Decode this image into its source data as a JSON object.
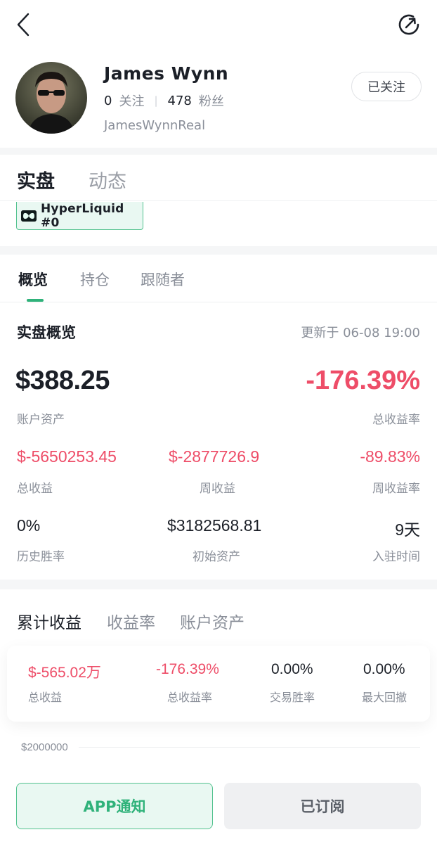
{
  "profile": {
    "name": "James Wynn",
    "following_count": "0",
    "following_label": "关注",
    "followers_count": "478",
    "followers_label": "粉丝",
    "handle": "JamesWynnReal",
    "follow_button": "已关注"
  },
  "main_tabs": [
    {
      "label": "实盘",
      "active": true
    },
    {
      "label": "动态",
      "active": false
    }
  ],
  "exchange": {
    "label": "HyperLiquid #0",
    "icon": "hyperliquid-logo"
  },
  "sub_tabs": [
    {
      "label": "概览",
      "active": true
    },
    {
      "label": "持仓",
      "active": false
    },
    {
      "label": "跟随者",
      "active": false
    }
  ],
  "overview": {
    "title": "实盘概览",
    "updated": "更新于 06-08 19:00",
    "account_asset": {
      "value": "$388.25",
      "label": "账户资产"
    },
    "total_return_rate": {
      "value": "-176.39%",
      "label": "总收益率"
    },
    "stats": [
      {
        "value": "$-5650253.45",
        "label": "总收益",
        "color": "#ee4d68"
      },
      {
        "value": "$-2877726.9",
        "label": "周收益",
        "color": "#ee4d68"
      },
      {
        "value": "-89.83%",
        "label": "周收益率",
        "color": "#ee4d68"
      },
      {
        "value": "0%",
        "label": "历史胜率",
        "color": "#1b1f27"
      },
      {
        "value": "$3182568.81",
        "label": "初始资产",
        "color": "#1b1f27"
      },
      {
        "value": "9天",
        "label": "入驻时间",
        "color": "#1b1f27"
      }
    ]
  },
  "chart_tabs": [
    {
      "label": "累计收益",
      "active": true
    },
    {
      "label": "收益率",
      "active": false
    },
    {
      "label": "账户资产",
      "active": false
    }
  ],
  "cumulative": [
    {
      "value": "$-565.02万",
      "label": "总收益",
      "color": "#ee4d68"
    },
    {
      "value": "-176.39%",
      "label": "总收益率",
      "color": "#ee4d68"
    },
    {
      "value": "0.00%",
      "label": "交易胜率",
      "color": "#1b1f27"
    },
    {
      "value": "0.00%",
      "label": "最大回撤",
      "color": "#1b1f27"
    }
  ],
  "chart": {
    "y_tick_label": "$2000000"
  },
  "bottom": {
    "app_notify": "APP通知",
    "subscribed": "已订阅"
  },
  "colors": {
    "accent_green": "#2fb27a",
    "negative_red": "#ee4d68",
    "muted_text": "#8a8f99"
  }
}
